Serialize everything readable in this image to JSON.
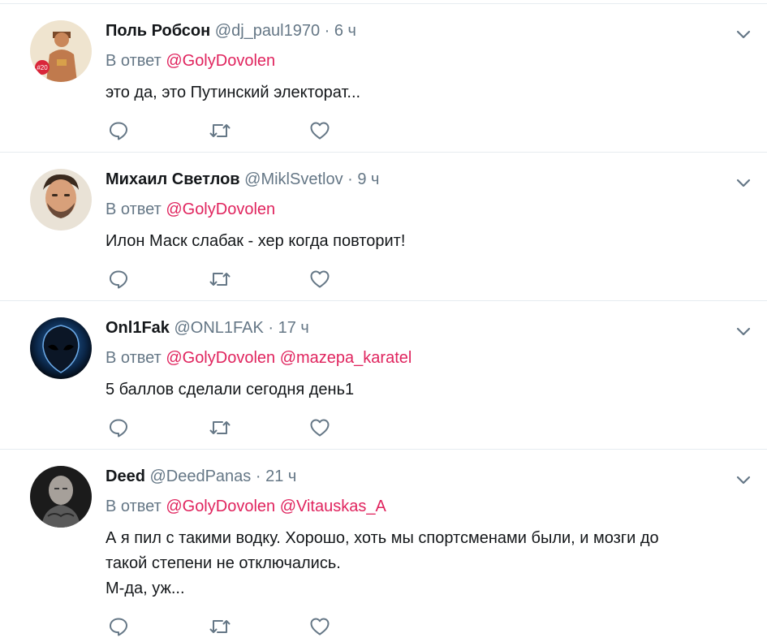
{
  "tweets": [
    {
      "author": "Поль Робсон",
      "handle": "@dj_paul1970",
      "sep": "·",
      "time": "6 ч",
      "reply_prefix": "В ответ",
      "mentions": [
        "@GolyDovolen"
      ],
      "text_lines": [
        "это да, это Путинский электорат..."
      ],
      "avatar_badge": "#20"
    },
    {
      "author": "Михаил Светлов",
      "handle": "@MiklSvetlov",
      "sep": "·",
      "time": "9 ч",
      "reply_prefix": "В ответ",
      "mentions": [
        "@GolyDovolen"
      ],
      "text_lines": [
        "Илон Маск слабак - хер когда повторит!"
      ]
    },
    {
      "author": "Onl1Fak",
      "handle": "@ONL1FAK",
      "sep": "·",
      "time": "17 ч",
      "reply_prefix": "В ответ",
      "mentions": [
        "@GolyDovolen",
        "@mazepa_karatel"
      ],
      "text_lines": [
        "5 баллов сделали сегодня день1"
      ]
    },
    {
      "author": "Deed",
      "handle": "@DeedPanas",
      "sep": "·",
      "time": "21 ч",
      "reply_prefix": "В ответ",
      "mentions": [
        "@GolyDovolen",
        "@Vitauskas_A"
      ],
      "text_lines": [
        "А я пил с такими водку. Хорошо, хоть мы спортсменами были, и мозги до",
        "такой степени не отключались.",
        "М-да, уж..."
      ]
    }
  ],
  "colors": {
    "mention": "#e0245e",
    "meta": "#657786",
    "text": "#14171a",
    "icon": "#657786"
  }
}
